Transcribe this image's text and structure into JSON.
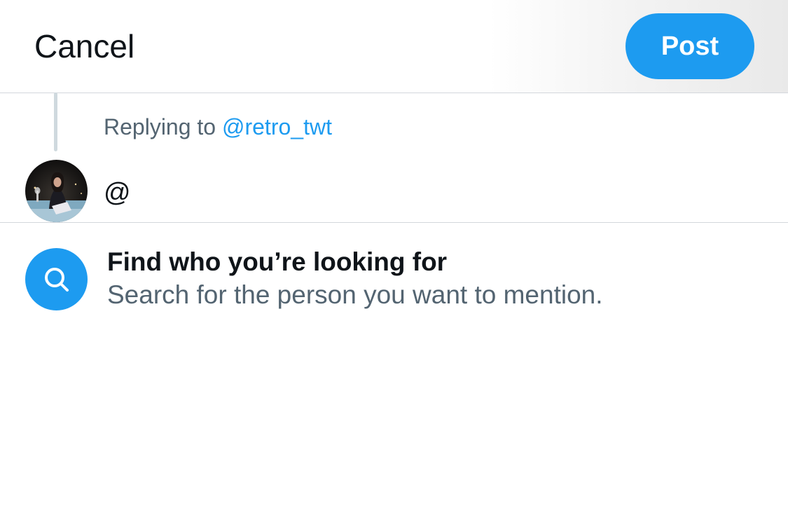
{
  "header": {
    "cancel_label": "Cancel",
    "post_label": "Post"
  },
  "reply": {
    "prefix": "Replying to ",
    "handle": "@retro_twt"
  },
  "compose": {
    "text": "@"
  },
  "mention_hint": {
    "title": "Find who you’re looking for",
    "subtitle": "Search for the person you want to mention."
  },
  "icons": {
    "search": "search-icon",
    "avatar": "user-avatar"
  },
  "colors": {
    "accent": "#1d9bf0",
    "text_primary": "#0f1419",
    "text_secondary": "#536471",
    "divider": "#d3d7dc",
    "thread_line": "#cfd9de"
  }
}
